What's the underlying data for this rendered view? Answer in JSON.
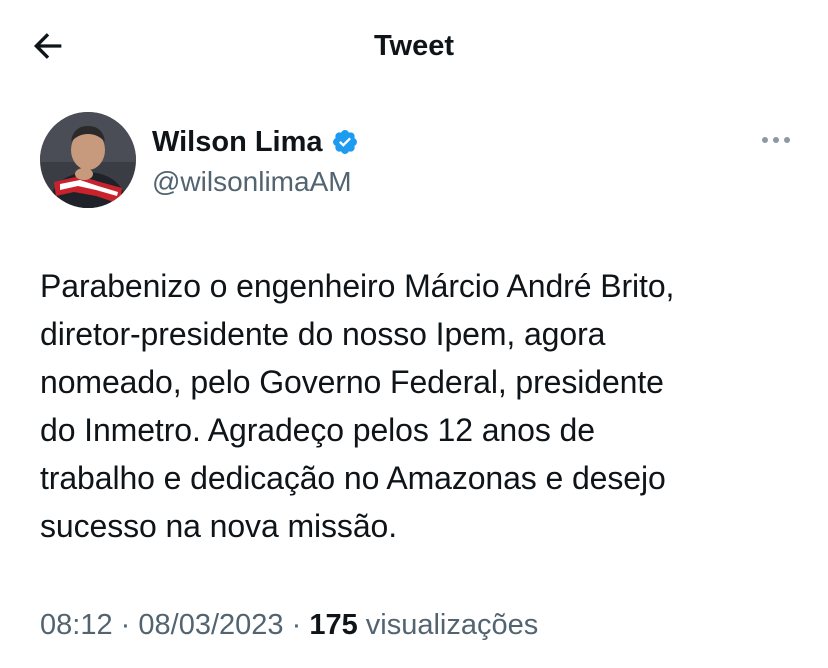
{
  "header": {
    "back_icon": "arrow-left-icon",
    "title": "Tweet"
  },
  "author": {
    "display_name": "Wilson Lima",
    "verified_icon": "verified-badge-icon",
    "verified_color": "#1d9bf0",
    "handle": "@wilsonlimaAM",
    "more_icon": "more-horizontal-icon"
  },
  "tweet": {
    "text": "Parabenizo o engenheiro Márcio André Brito,\ndiretor-presidente do nosso Ipem, agora\nnomeado, pelo Governo Federal, presidente\ndo Inmetro. Agradeço pelos 12 anos de\ntrabalho e dedicação no Amazonas e desejo\nsucesso na nova missão."
  },
  "meta": {
    "time": "08:12",
    "separator": "·",
    "date": "08/03/2023",
    "views_count": "175",
    "views_label": "visualizações"
  },
  "colors": {
    "text_primary": "#0f1419",
    "text_secondary": "#536471",
    "accent": "#1d9bf0"
  }
}
